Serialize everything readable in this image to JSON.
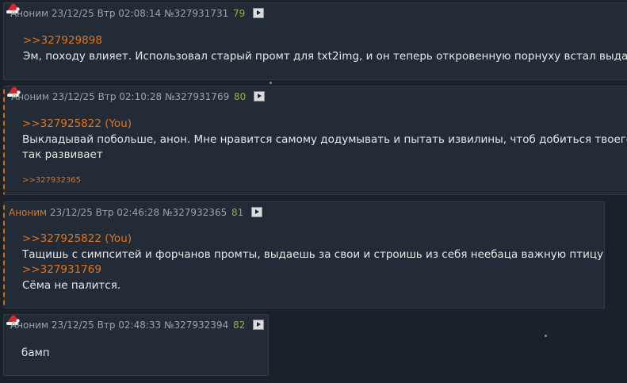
{
  "posts": [
    {
      "name": "Аноним",
      "datetime": "23/12/25 Втр 02:08:14",
      "number": "№327931731",
      "count": "79",
      "reply_link": ">>327929898",
      "text": "Эм, походу влияет. Использовал старый промт для txt2img, и он теперь откровенную порнуху встал выдавать"
    },
    {
      "name": "Аноним",
      "datetime": "23/12/25 Втр 02:10:28",
      "number": "№327931769",
      "count": "80",
      "reply_link": ">>327925822 (You)",
      "text_line1": "Выкладывай побольше, анон. Мне нравится самому додумывать и пытать извилины, чтоб добиться твоего результата",
      "text_line2": "так развивает",
      "backlink": ">>327932365"
    },
    {
      "name": "Аноним",
      "datetime": "23/12/25 Втр 02:46:28",
      "number": "№327932365",
      "count": "81",
      "reply_link1": ">>327925822 (You)",
      "text_line1": "Тащишь с симпситей и форчанов промты, выдаешь за свои и строишь из себя неебаца важную птицу.",
      "reply_link2": ">>327931769",
      "text_line2": "Сёма не палится."
    },
    {
      "name": "Аноним",
      "datetime": "23/12/25 Втр 02:48:33",
      "number": "№327932394",
      "count": "82",
      "text": "бамп"
    }
  ],
  "colors": {
    "background": "#1b2129",
    "post_bg": "#222b36",
    "reply_link": "#e0741e",
    "post_count": "#8fb630"
  }
}
